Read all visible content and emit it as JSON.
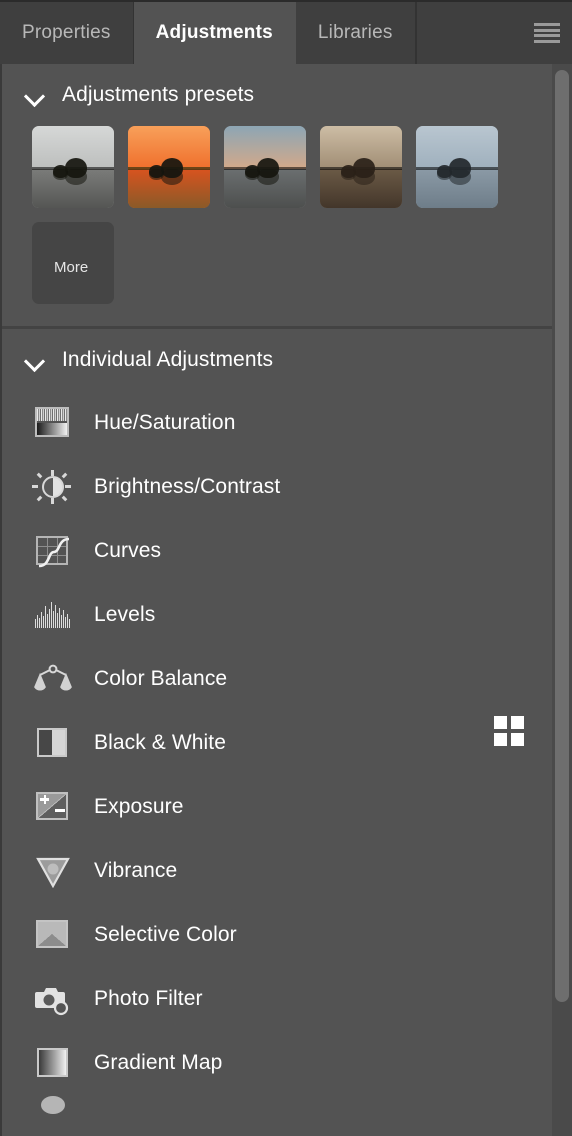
{
  "window": {
    "title": "Adjustments",
    "menu_icon": "hamburger-menu-icon"
  },
  "tabs": [
    {
      "label": "Properties",
      "active": false
    },
    {
      "label": "Adjustments",
      "active": true
    },
    {
      "label": "Libraries",
      "active": false
    }
  ],
  "presets_section": {
    "title": "Adjustments presets",
    "expanded": true,
    "chevron_icon": "chevron-down-icon",
    "more_label": "More",
    "thumbnails": [
      {
        "name": "preset-black-and-white",
        "sky": "#cfd1d0",
        "ground": "#8e8f8d",
        "water": "#6a6b69"
      },
      {
        "name": "preset-warm-sunset",
        "sky": "#f58a3c",
        "ground": "#e2612a",
        "water": "#b8531f"
      },
      {
        "name": "preset-cool-dusk",
        "sky": "#8da6b5",
        "ground": "#caa083",
        "water": "#6b6f70"
      },
      {
        "name": "preset-sepia-tone",
        "sky": "#cdbda5",
        "ground": "#8c7a63",
        "water": "#57483a"
      },
      {
        "name": "preset-blue-cold",
        "sky": "#aebdc9",
        "ground": "#97a5b0",
        "water": "#7d8c99"
      }
    ]
  },
  "individual_section": {
    "title": "Individual Adjustments",
    "expanded": true,
    "chevron_icon": "chevron-down-icon",
    "view_toggle_icon": "grid-view-icon",
    "items": [
      {
        "label": "Hue/Saturation",
        "icon": "hue-saturation-icon"
      },
      {
        "label": "Brightness/Contrast",
        "icon": "brightness-contrast-icon"
      },
      {
        "label": "Curves",
        "icon": "curves-icon"
      },
      {
        "label": "Levels",
        "icon": "levels-icon"
      },
      {
        "label": "Color Balance",
        "icon": "color-balance-icon"
      },
      {
        "label": "Black & White",
        "icon": "black-and-white-icon"
      },
      {
        "label": "Exposure",
        "icon": "exposure-icon"
      },
      {
        "label": "Vibrance",
        "icon": "vibrance-icon"
      },
      {
        "label": "Selective Color",
        "icon": "selective-color-icon"
      },
      {
        "label": "Photo Filter",
        "icon": "photo-filter-icon"
      },
      {
        "label": "Gradient Map",
        "icon": "gradient-map-icon"
      }
    ]
  },
  "scrollbar": {
    "orientation": "vertical"
  },
  "colors": {
    "panel_background": "#535353",
    "tabbar_background": "#3f3f3f",
    "active_tab_background": "#535353",
    "text_primary": "#ffffff",
    "text_muted": "#b8b8b8",
    "scrollbar_thumb": "#6e6e6e"
  }
}
